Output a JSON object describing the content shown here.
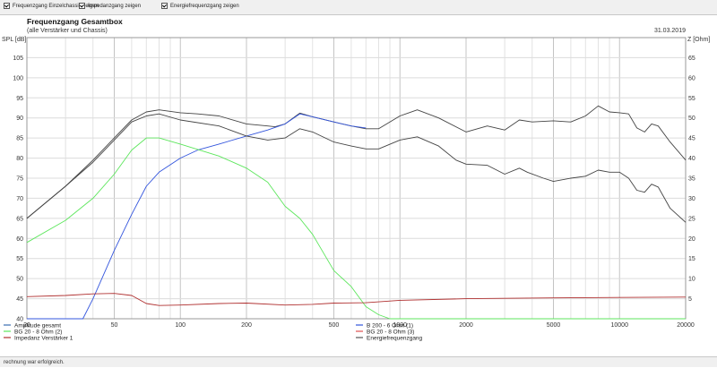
{
  "toolbar": {
    "checkboxes": [
      {
        "label": "Frequenzgang Einzelchassis zeigen",
        "checked": true
      },
      {
        "label": "Impedanzgang zeigen",
        "checked": true
      },
      {
        "label": "Energiefrequenzgang zeigen",
        "checked": true
      }
    ]
  },
  "status_text": "rechnung war erfolgreich.",
  "chart_data": {
    "type": "line",
    "title": "Frequenzgang Gesamtbox",
    "subtitle": "(alle Verstärker und Chassis)",
    "date": "31.03.2019",
    "ylabel_left": "SPL [dB]",
    "ylabel_right": "Z [Ohm]",
    "x_scale": "log",
    "xlim": [
      20,
      20000
    ],
    "ylim_left": [
      40,
      110
    ],
    "ylim_right": [
      0,
      70
    ],
    "x_ticks": [
      20,
      50,
      100,
      200,
      500,
      1000,
      2000,
      5000,
      10000,
      20000
    ],
    "x_tick_labels": [
      "20",
      "50",
      "100",
      "200",
      "500",
      "1000",
      "2000",
      "5000",
      "10000",
      "20000"
    ],
    "y_ticks_left": [
      40,
      45,
      50,
      55,
      60,
      65,
      70,
      75,
      80,
      85,
      90,
      95,
      100,
      105
    ],
    "y_ticks_right": [
      5,
      10,
      15,
      20,
      25,
      30,
      35,
      40,
      45,
      50,
      55,
      60,
      65
    ],
    "grid": true,
    "legend_position": "bottom",
    "legend": [
      {
        "label": "Amplitude gesamt",
        "color": "#3a6fb0",
        "col": 0,
        "row": 0
      },
      {
        "label": "BG 20 - 8 Ohm       (2)",
        "color": "#5ce65c",
        "col": 0,
        "row": 1
      },
      {
        "label": "Impedanz Verstärker 1",
        "color": "#b03030",
        "col": 0,
        "row": 2
      },
      {
        "label": "B 200 - 6 Ohm (1)",
        "color": "#3355dd",
        "col": 1,
        "row": 0
      },
      {
        "label": "BG 20 - 8 Ohm       (3)",
        "color": "#e05050",
        "col": 1,
        "row": 1
      },
      {
        "label": "Energiefrequenzgang",
        "color": "#555555",
        "col": 1,
        "row": 2
      }
    ],
    "series": [
      {
        "name": "Amplitude gesamt",
        "axis": "left",
        "color": "#444444",
        "points": [
          [
            20,
            65
          ],
          [
            30,
            73
          ],
          [
            40,
            79.5
          ],
          [
            50,
            85
          ],
          [
            60,
            89.5
          ],
          [
            70,
            91.5
          ],
          [
            80,
            92
          ],
          [
            100,
            91.3
          ],
          [
            120,
            91
          ],
          [
            150,
            90.5
          ],
          [
            200,
            88.5
          ],
          [
            250,
            88
          ],
          [
            270,
            87.8
          ],
          [
            300,
            88.5
          ],
          [
            350,
            91.2
          ],
          [
            400,
            90.3
          ],
          [
            500,
            89
          ],
          [
            600,
            88
          ],
          [
            700,
            87.3
          ],
          [
            800,
            87.3
          ],
          [
            1000,
            90.5
          ],
          [
            1200,
            92
          ],
          [
            1500,
            90
          ],
          [
            2000,
            86.5
          ],
          [
            2500,
            88
          ],
          [
            3000,
            87
          ],
          [
            3500,
            89.5
          ],
          [
            4000,
            89
          ],
          [
            5000,
            89.3
          ],
          [
            6000,
            89
          ],
          [
            7000,
            90.5
          ],
          [
            8000,
            93
          ],
          [
            9000,
            91.5
          ],
          [
            10000,
            91.3
          ],
          [
            11000,
            91
          ],
          [
            12000,
            87.5
          ],
          [
            13000,
            86.5
          ],
          [
            14000,
            88.5
          ],
          [
            15000,
            88
          ],
          [
            17000,
            84
          ],
          [
            20000,
            79.5
          ]
        ]
      },
      {
        "name": "B 200 - 6 Ohm (1)",
        "axis": "left",
        "color": "#3355dd",
        "points": [
          [
            20,
            40
          ],
          [
            36,
            40
          ],
          [
            40,
            45
          ],
          [
            50,
            57
          ],
          [
            60,
            66
          ],
          [
            70,
            73
          ],
          [
            80,
            76.5
          ],
          [
            100,
            80
          ],
          [
            120,
            82
          ],
          [
            150,
            83.5
          ],
          [
            200,
            85.5
          ],
          [
            250,
            87
          ],
          [
            300,
            88.5
          ],
          [
            350,
            91
          ],
          [
            400,
            90.3
          ],
          [
            500,
            89
          ],
          [
            600,
            88
          ],
          [
            700,
            87.5
          ]
        ]
      },
      {
        "name": "BG 20 - 8 Ohm       (2)",
        "axis": "left",
        "color": "#5ce65c",
        "points": [
          [
            20,
            59
          ],
          [
            30,
            64.5
          ],
          [
            40,
            70
          ],
          [
            50,
            76
          ],
          [
            60,
            82
          ],
          [
            70,
            85
          ],
          [
            80,
            85
          ],
          [
            100,
            83.5
          ],
          [
            150,
            80.5
          ],
          [
            200,
            77.5
          ],
          [
            250,
            74
          ],
          [
            300,
            68
          ],
          [
            350,
            65
          ],
          [
            400,
            61
          ],
          [
            500,
            52
          ],
          [
            600,
            48
          ],
          [
            700,
            43
          ],
          [
            800,
            41
          ],
          [
            900,
            40
          ],
          [
            20000,
            40
          ]
        ]
      },
      {
        "name": "Energiefrequenzgang",
        "axis": "left",
        "color": "#444444",
        "points": [
          [
            20,
            65
          ],
          [
            30,
            73
          ],
          [
            40,
            79
          ],
          [
            50,
            84.5
          ],
          [
            60,
            89
          ],
          [
            70,
            90.5
          ],
          [
            80,
            91
          ],
          [
            100,
            89.5
          ],
          [
            150,
            88
          ],
          [
            200,
            85.5
          ],
          [
            250,
            84.5
          ],
          [
            300,
            85
          ],
          [
            350,
            87.3
          ],
          [
            400,
            86.5
          ],
          [
            500,
            84
          ],
          [
            600,
            83
          ],
          [
            700,
            82.3
          ],
          [
            800,
            82.3
          ],
          [
            1000,
            84.5
          ],
          [
            1200,
            85.3
          ],
          [
            1500,
            83
          ],
          [
            1800,
            79.5
          ],
          [
            2000,
            78.5
          ],
          [
            2500,
            78.2
          ],
          [
            3000,
            76
          ],
          [
            3500,
            77.5
          ],
          [
            3800,
            76.5
          ],
          [
            4500,
            75
          ],
          [
            5000,
            74.2
          ],
          [
            6000,
            75
          ],
          [
            7000,
            75.5
          ],
          [
            8000,
            77
          ],
          [
            9000,
            76.5
          ],
          [
            10000,
            76.5
          ],
          [
            11000,
            75
          ],
          [
            12000,
            72
          ],
          [
            13000,
            71.5
          ],
          [
            14000,
            73.5
          ],
          [
            15000,
            72.8
          ],
          [
            17000,
            67.5
          ],
          [
            20000,
            64
          ]
        ]
      },
      {
        "name": "Impedanz Verstärker 1",
        "axis": "right",
        "color": "#b03030",
        "points": [
          [
            20,
            5.5
          ],
          [
            30,
            5.8
          ],
          [
            40,
            6.2
          ],
          [
            50,
            6.3
          ],
          [
            60,
            5.8
          ],
          [
            70,
            3.8
          ],
          [
            80,
            3.3
          ],
          [
            100,
            3.4
          ],
          [
            150,
            3.8
          ],
          [
            200,
            3.9
          ],
          [
            300,
            3.4
          ],
          [
            400,
            3.6
          ],
          [
            500,
            3.9
          ],
          [
            700,
            4
          ],
          [
            1000,
            4.6
          ],
          [
            2000,
            5
          ],
          [
            5000,
            5.2
          ],
          [
            10000,
            5.3
          ],
          [
            20000,
            5.4
          ]
        ]
      }
    ]
  }
}
